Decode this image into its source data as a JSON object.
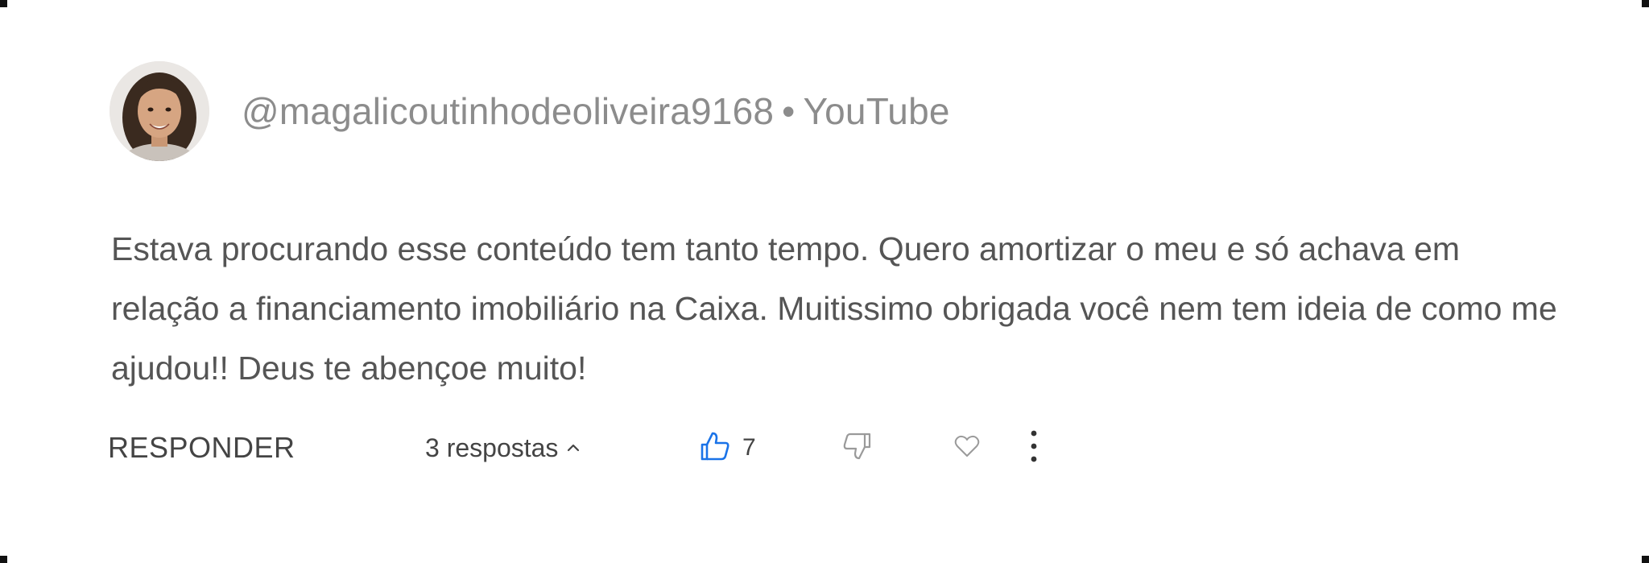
{
  "comment": {
    "author_handle": "@magalicoutinhodeoliveira9168",
    "separator": "•",
    "platform": "YouTube",
    "text": "Estava procurando esse conteúdo tem tanto tempo. Quero amortizar o meu e só achava em relação a financiamento imobiliário na Caixa. Muitissimo obrigada você nem tem ideia de como me ajudou!! Deus te abençoe muito!",
    "actions": {
      "reply_label": "RESPONDER",
      "replies_label": "3 respostas",
      "like_count": "7"
    },
    "colors": {
      "like_accent": "#1a73e8",
      "muted_icon": "#9a9a9a",
      "author_text": "#8c8c8c",
      "body_text": "#555555"
    },
    "icons": {
      "avatar": "avatar",
      "replies_toggle": "chevron-up-icon",
      "like": "thumbs-up-icon",
      "dislike": "thumbs-down-icon",
      "heart": "heart-icon",
      "more": "more-vertical-icon"
    }
  }
}
